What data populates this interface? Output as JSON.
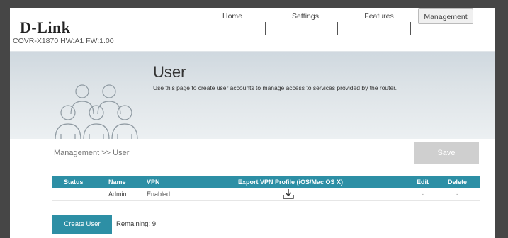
{
  "header": {
    "brand": "D-Link",
    "device": "COVR-X1870 HW:A1 FW:1.00",
    "nav": [
      {
        "label": "Home"
      },
      {
        "label": "Settings"
      },
      {
        "label": "Features"
      },
      {
        "label": "Management"
      }
    ]
  },
  "hero": {
    "title": "User",
    "description": "Use this page to create user accounts to manage access to services provided by the router.",
    "icon": "users-icon"
  },
  "breadcrumb": "Management >> User",
  "save_label": "Save",
  "table": {
    "columns": [
      "Status",
      "Name",
      "VPN",
      "Export VPN Profile (iOS/Mac OS X)",
      "Edit",
      "Delete"
    ],
    "rows": [
      {
        "status": "",
        "name": "Admin",
        "vpn": "Enabled",
        "export_icon": "download-icon",
        "edit": "-",
        "delete": "-"
      }
    ]
  },
  "create_user_label": "Create User",
  "remaining": "Remaining: 9",
  "colors": {
    "accent": "#2d8fa5",
    "save_disabled": "#cfcfcf"
  }
}
